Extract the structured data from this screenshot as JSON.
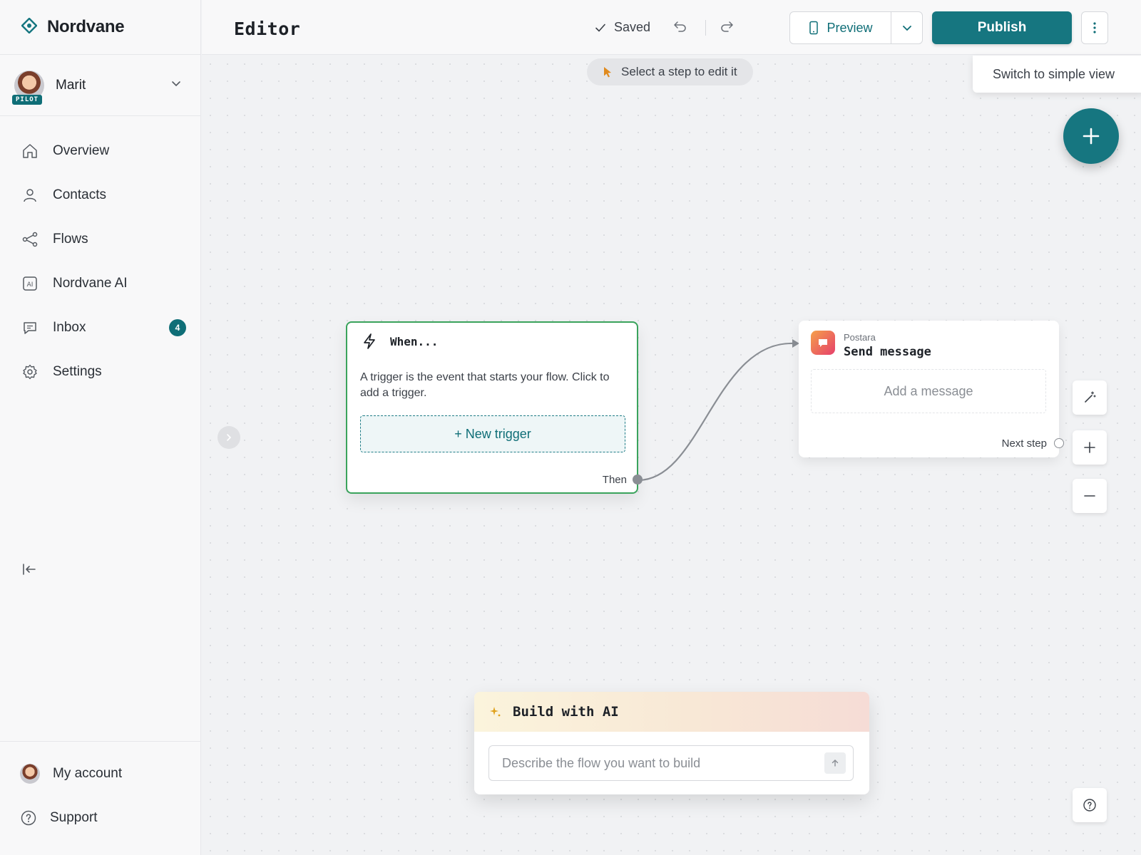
{
  "brand": {
    "name": "Nordvane",
    "accent": "#167680"
  },
  "user": {
    "name": "Marit",
    "badge": "PILOT"
  },
  "nav": [
    {
      "label": "Overview",
      "icon": "home-icon"
    },
    {
      "label": "Contacts",
      "icon": "person-icon"
    },
    {
      "label": "Flows",
      "icon": "share-nodes-icon"
    },
    {
      "label": "Nordvane AI",
      "icon": "ai-icon"
    },
    {
      "label": "Inbox",
      "icon": "chat-icon",
      "badge": "4"
    },
    {
      "label": "Settings",
      "icon": "gear-icon"
    }
  ],
  "sidebar_bottom": {
    "account": "My account",
    "support": "Support"
  },
  "topbar": {
    "title": "Editor",
    "saved": "Saved",
    "preview": "Preview",
    "publish": "Publish"
  },
  "canvas": {
    "hint": "Select a step to edit it",
    "switch_view": "Switch to simple view",
    "trigger": {
      "title": "When...",
      "description": "A trigger is the event that starts your flow. Click to add a trigger.",
      "button": "+ New trigger",
      "port_label": "Then",
      "border_color": "#3aa35c"
    },
    "message_step": {
      "app": "Postara",
      "title": "Send message",
      "placeholder": "Add a message",
      "port_label": "Next step"
    }
  },
  "ai_panel": {
    "title": "Build with AI",
    "placeholder": "Describe the flow you want to build"
  }
}
